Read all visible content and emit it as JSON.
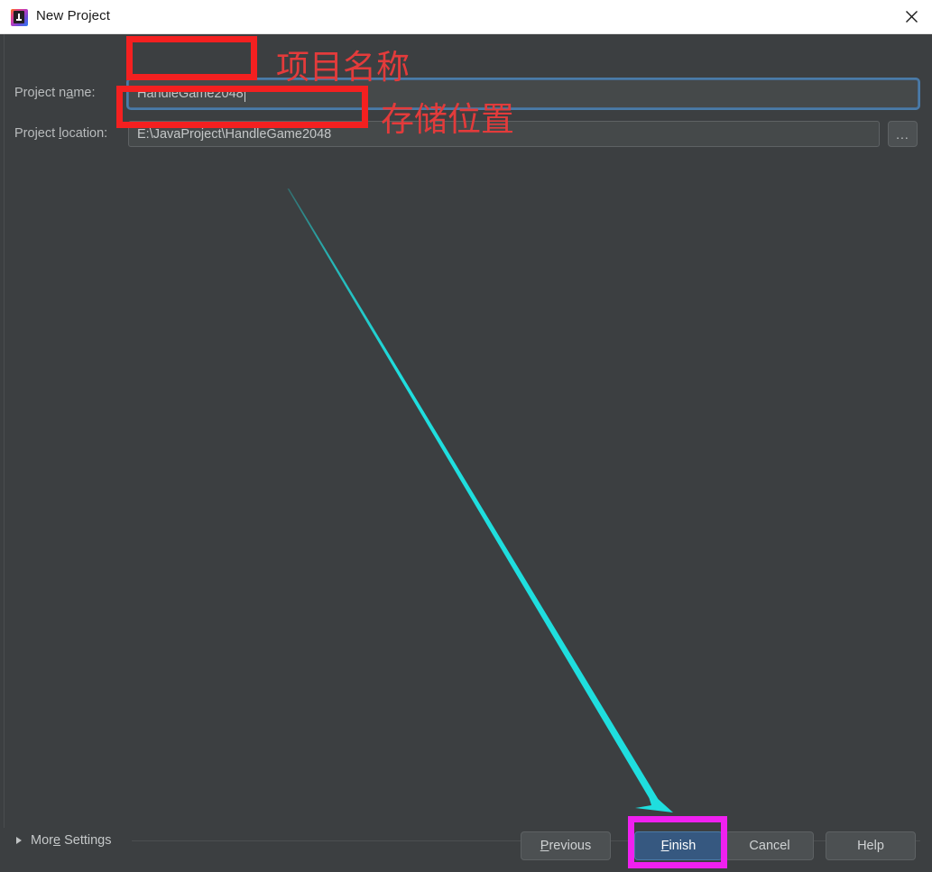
{
  "window": {
    "title": "New Project",
    "app_icon": "intellij-idea-icon",
    "close_icon": "close-icon"
  },
  "form": {
    "name_row": {
      "label_prefix": "Project n",
      "label_mnemonic": "a",
      "label_suffix": "me:",
      "value": "HandleGame2048",
      "focused": true
    },
    "location_row": {
      "label_prefix": "Project ",
      "label_mnemonic": "l",
      "label_suffix": "ocation:",
      "value": "E:\\JavaProject\\HandleGame2048",
      "browse_label": "...",
      "browse_icon": "ellipsis-icon"
    }
  },
  "more_settings": {
    "prefix": "Mor",
    "mnemonic": "e",
    "suffix": " Settings",
    "expand_icon": "chevron-right-icon",
    "expanded": false
  },
  "footer": {
    "previous": {
      "prefix": "",
      "mnemonic": "P",
      "suffix": "revious"
    },
    "finish": {
      "prefix": "",
      "mnemonic": "F",
      "suffix": "inish"
    },
    "cancel": {
      "prefix": "Cancel",
      "mnemonic": "",
      "suffix": ""
    },
    "help": {
      "prefix": "Help",
      "mnemonic": "",
      "suffix": ""
    }
  },
  "annotations": {
    "project_name_note": "项目名称",
    "project_location_note": "存储位置",
    "highlight_color_red": "#f42020",
    "highlight_color_magenta": "#f020f0",
    "arrow_color": "#1fdede"
  },
  "colors": {
    "dialog_background": "#3c3f41",
    "titlebar_background": "#ffffff",
    "field_background": "#45494a",
    "primary_button": "#365880",
    "focus_ring": "#4a7ba8",
    "text": "#c4c7c8"
  }
}
